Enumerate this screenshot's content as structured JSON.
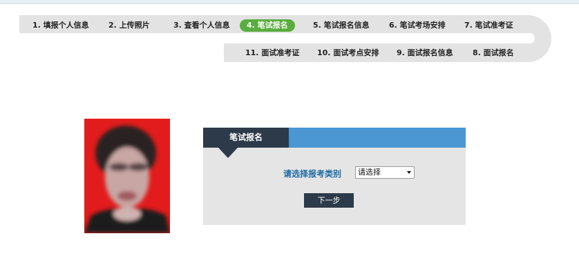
{
  "steps_row1": [
    {
      "label": "1. 填报个人信息",
      "active": false
    },
    {
      "label": "2. 上传照片",
      "active": false
    },
    {
      "label": "3. 查看个人信息",
      "active": false
    },
    {
      "label": "4. 笔试报名",
      "active": true
    },
    {
      "label": "5. 笔试报名信息",
      "active": false
    },
    {
      "label": "6. 笔试考场安排",
      "active": false
    },
    {
      "label": "7. 笔试准考证",
      "active": false
    }
  ],
  "steps_row2": [
    {
      "label": "11. 面试准考证"
    },
    {
      "label": "10. 面试考点安排"
    },
    {
      "label": "9. 面试报名信息"
    },
    {
      "label": "8. 面试报名"
    }
  ],
  "panel": {
    "tab_title": "笔试报名",
    "field_label": "请选择报考类别",
    "select_value": "请选择",
    "next_button": "下一步"
  },
  "colors": {
    "active_step": "#5aad3f",
    "panel_header": "#4a97d4",
    "panel_tab": "#2d3a4a",
    "photo_background": "#e21c1c"
  }
}
